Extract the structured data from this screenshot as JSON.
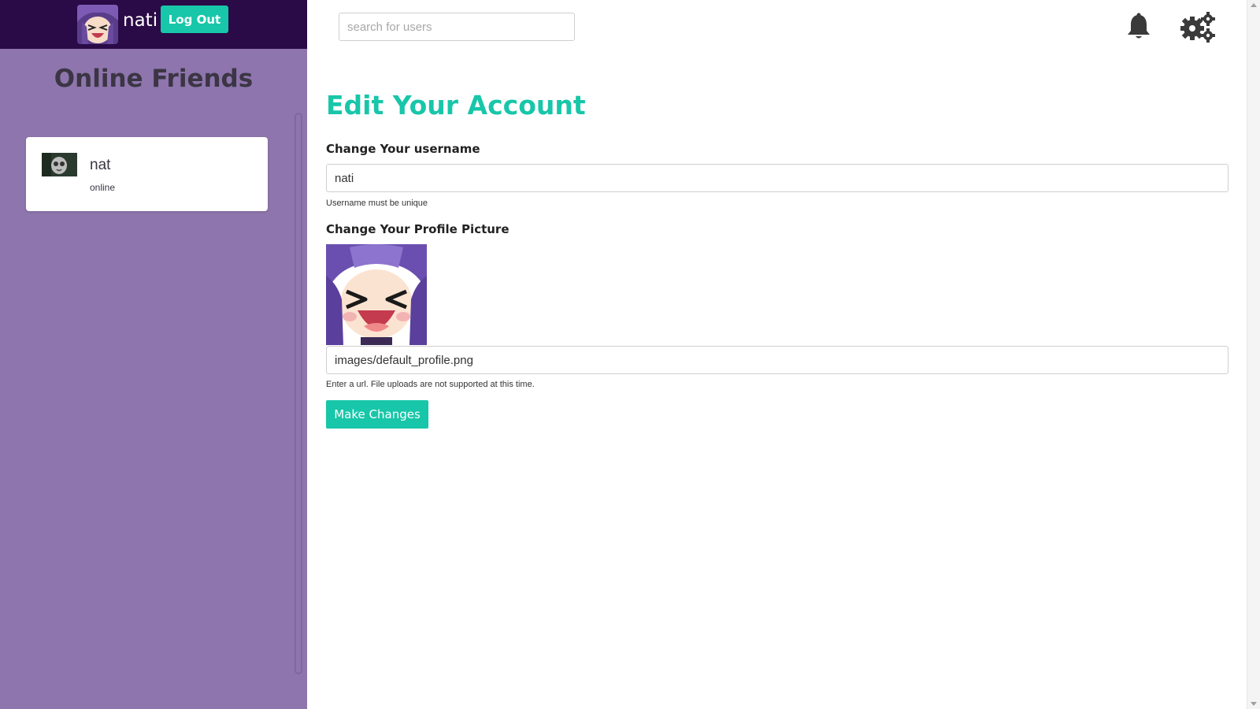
{
  "header": {
    "username": "nati",
    "logout_label": "Log Out",
    "search_placeholder": "search for users",
    "bell_icon": "bell-icon",
    "gear_icon": "gear-icon"
  },
  "sidebar": {
    "title": "Online Friends",
    "friends": [
      {
        "name": "nat",
        "status": "online"
      }
    ]
  },
  "main": {
    "title": "Edit Your Account",
    "username_label": "Change Your username",
    "username_value": "nati",
    "username_help": "Username must be unique",
    "picture_label": "Change Your Profile Picture",
    "picture_value": "images/default_profile.png",
    "picture_help": "Enter a url. File uploads are not supported at this time.",
    "submit_label": "Make Changes"
  },
  "colors": {
    "accent": "#18c6a9",
    "sidebar_bg": "#8e75ad",
    "topbar_bg": "#2a0a47"
  }
}
